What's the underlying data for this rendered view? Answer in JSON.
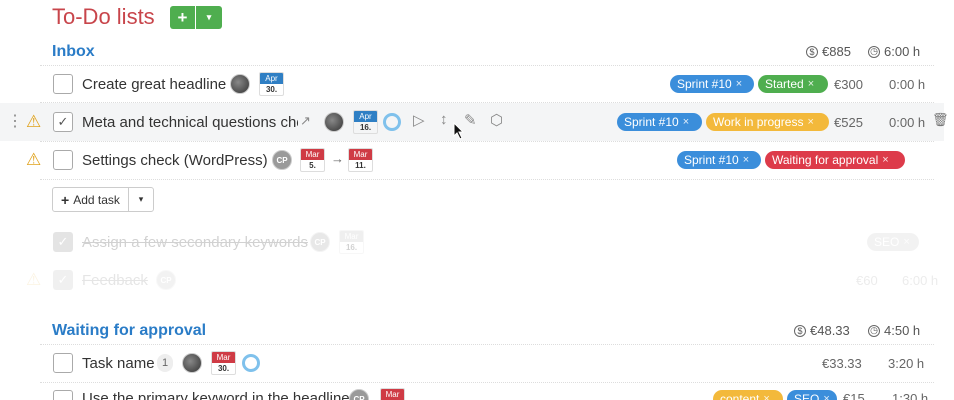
{
  "header": {
    "title": "To-Do lists",
    "add_label": "+",
    "caret": "▾"
  },
  "inbox": {
    "title": "Inbox",
    "budget": "€885",
    "time": "6:00 h",
    "tasks": [
      {
        "name": "Create great headline",
        "date_month": "Apr",
        "date_day": "30.",
        "tags": [
          "Sprint #10",
          "Started"
        ],
        "price": "€300",
        "hours": "0:00 h"
      },
      {
        "name": "Meta and technical questions che",
        "date_month": "Apr",
        "date_day": "16.",
        "tags": [
          "Sprint #10",
          "Work in progress"
        ],
        "price": "€525",
        "hours": "0:00 h"
      },
      {
        "name": "Settings check (WordPress)",
        "avatar": "CP",
        "date_month": "Mar",
        "date_day": "5.",
        "arrow": "→",
        "date2_month": "Mar",
        "date2_day": "11.",
        "tags": [
          "Sprint #10",
          "Waiting for approval"
        ]
      }
    ],
    "add_task_label": "Add task",
    "done_tasks": [
      {
        "name": "Assign a few secondary keywords",
        "avatar": "CP",
        "date_month": "Mar",
        "date_day": "16.",
        "tags": [
          "SEO"
        ]
      },
      {
        "name": "Feedback",
        "avatar": "CP",
        "price": "€60",
        "hours": "6:00 h"
      }
    ]
  },
  "waiting": {
    "title": "Waiting for approval",
    "budget": "€48.33",
    "time": "4:50 h",
    "tasks": [
      {
        "name": "Task name",
        "count": "1",
        "date_month": "Mar",
        "date_day": "30.",
        "price": "€33.33",
        "hours": "3:20 h"
      },
      {
        "name": "Use the primary keyword in the headline",
        "avatar": "CP",
        "date_month": "Mar",
        "tags": [
          "content",
          "SEO"
        ],
        "price": "€15",
        "hours": "1:30 h"
      }
    ]
  },
  "icons": {
    "euro_circle": "$",
    "clock": "◷",
    "warning": "⚠",
    "check": "✓",
    "tag_close": "×",
    "drag": "⋮",
    "open_link": "↗",
    "play": "▷",
    "move": "↕",
    "edit": "✎",
    "tag": "⬡",
    "trash": "🗑",
    "plus": "+"
  }
}
